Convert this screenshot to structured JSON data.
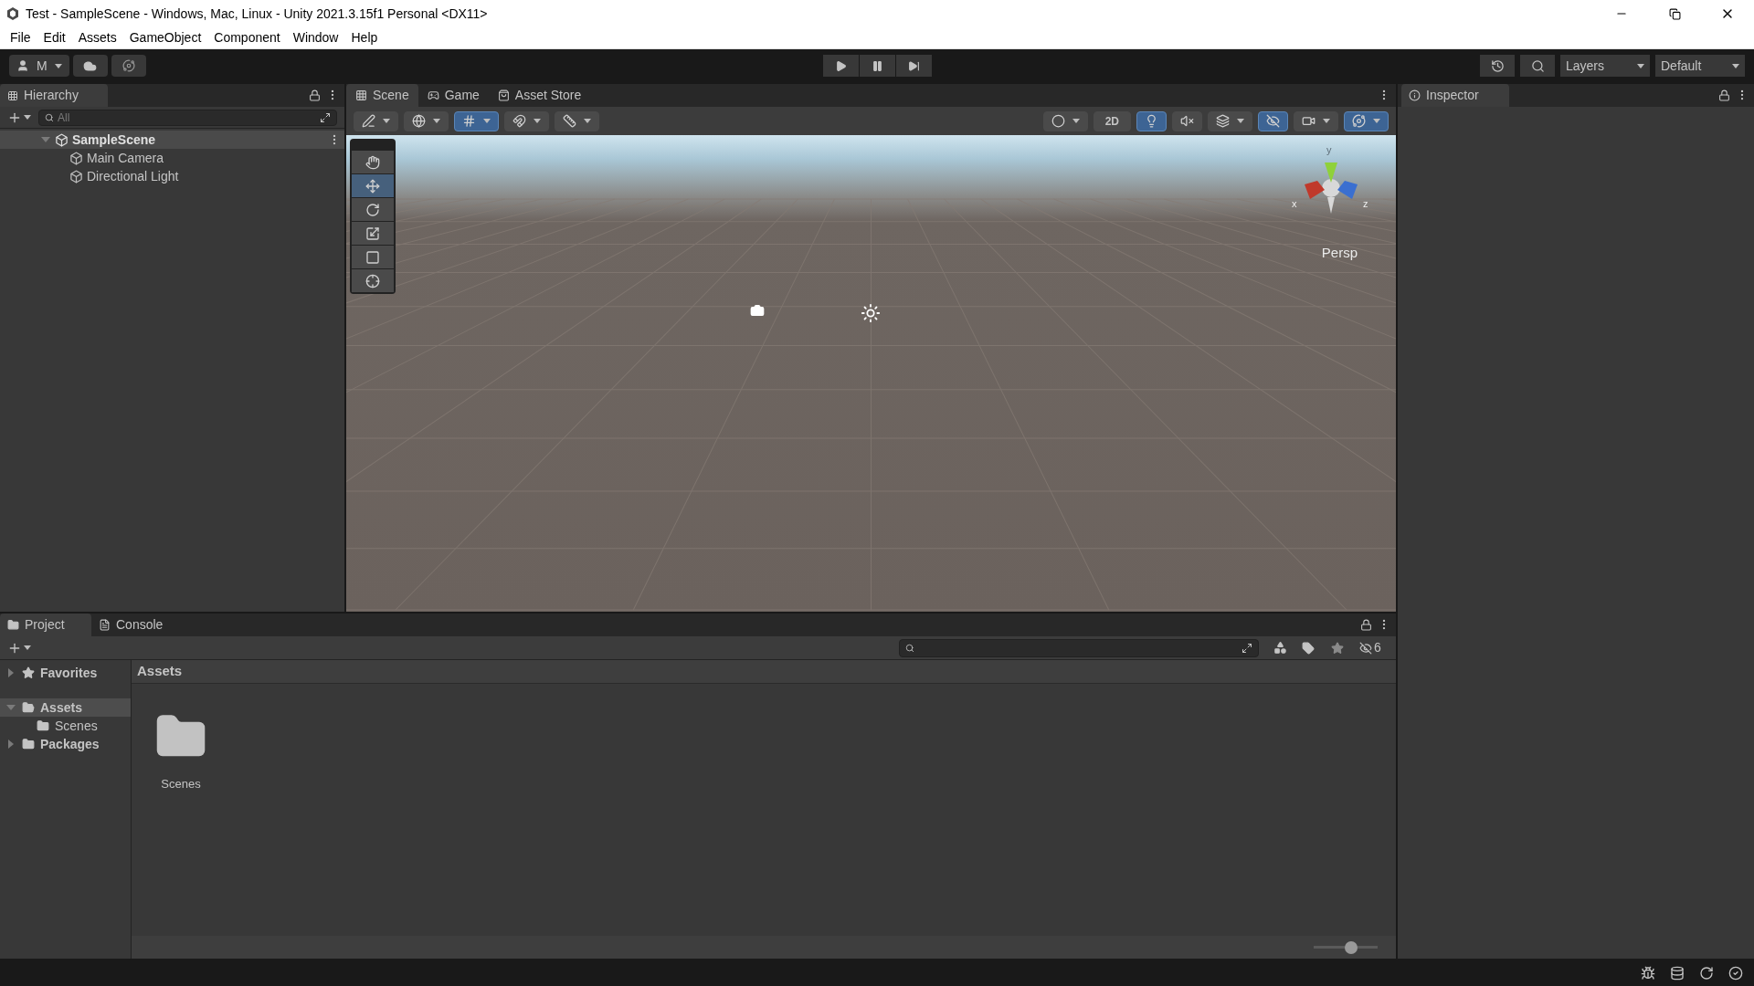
{
  "window": {
    "title": "Test - SampleScene - Windows, Mac, Linux - Unity 2021.3.15f1 Personal <DX11>"
  },
  "menu": [
    "File",
    "Edit",
    "Assets",
    "GameObject",
    "Component",
    "Window",
    "Help"
  ],
  "toolbar": {
    "account": "M",
    "layers": "Layers",
    "layout": "Default"
  },
  "hierarchy": {
    "tab": "Hierarchy",
    "search_placeholder": "All",
    "tree": [
      {
        "label": "SampleScene",
        "expanded": true,
        "selected": true,
        "children": [
          {
            "label": "Main Camera",
            "selected": false
          },
          {
            "label": "Directional Light",
            "selected": false
          }
        ]
      }
    ]
  },
  "scene_tabs": [
    {
      "label": "Scene",
      "kind": "grid",
      "selected": true
    },
    {
      "label": "Game",
      "kind": "gamepad",
      "selected": false
    },
    {
      "label": "Asset Store",
      "kind": "bag",
      "selected": false
    }
  ],
  "scene_toolbar_left": [
    {
      "kind": "shading",
      "on": false
    },
    {
      "kind": "globe",
      "on": false
    },
    {
      "kind": "grid-snap",
      "on": true
    },
    {
      "kind": "snap",
      "on": false
    },
    {
      "kind": "increment",
      "on": false
    }
  ],
  "scene_toolbar_right": [
    {
      "kind": "draw-mode",
      "on": false
    },
    {
      "kind": "text",
      "label": "2D",
      "on": false
    },
    {
      "kind": "light",
      "on": true
    },
    {
      "kind": "audio",
      "on": false
    },
    {
      "kind": "effects",
      "on": false
    },
    {
      "kind": "hidden",
      "on": true
    },
    {
      "kind": "camera",
      "on": false
    },
    {
      "kind": "gizmos",
      "on": true
    }
  ],
  "tools": [
    {
      "kind": "hand",
      "selected": false
    },
    {
      "kind": "move",
      "selected": true
    },
    {
      "kind": "rotate",
      "selected": false
    },
    {
      "kind": "scale",
      "selected": false
    },
    {
      "kind": "rect",
      "selected": false
    },
    {
      "kind": "transform",
      "selected": false
    }
  ],
  "gizmo": {
    "x": "x",
    "y": "y",
    "z": "z",
    "projection": "Persp"
  },
  "inspector": {
    "tab": "Inspector"
  },
  "project": {
    "tabs": [
      {
        "label": "Project",
        "kind": "folder",
        "selected": true
      },
      {
        "label": "Console",
        "kind": "console",
        "selected": false
      }
    ],
    "hidden_count": "6",
    "tree": [
      {
        "label": "Favorites",
        "kind": "star",
        "expanded": false,
        "selected": false
      },
      {
        "label": "Assets",
        "kind": "folder",
        "expanded": true,
        "selected": true,
        "children": [
          {
            "label": "Scenes"
          }
        ]
      },
      {
        "label": "Packages",
        "kind": "folder",
        "expanded": false,
        "selected": false
      }
    ],
    "breadcrumb": "Assets",
    "items": [
      {
        "label": "Scenes"
      }
    ],
    "zoom": {
      "level": 0.58
    }
  }
}
